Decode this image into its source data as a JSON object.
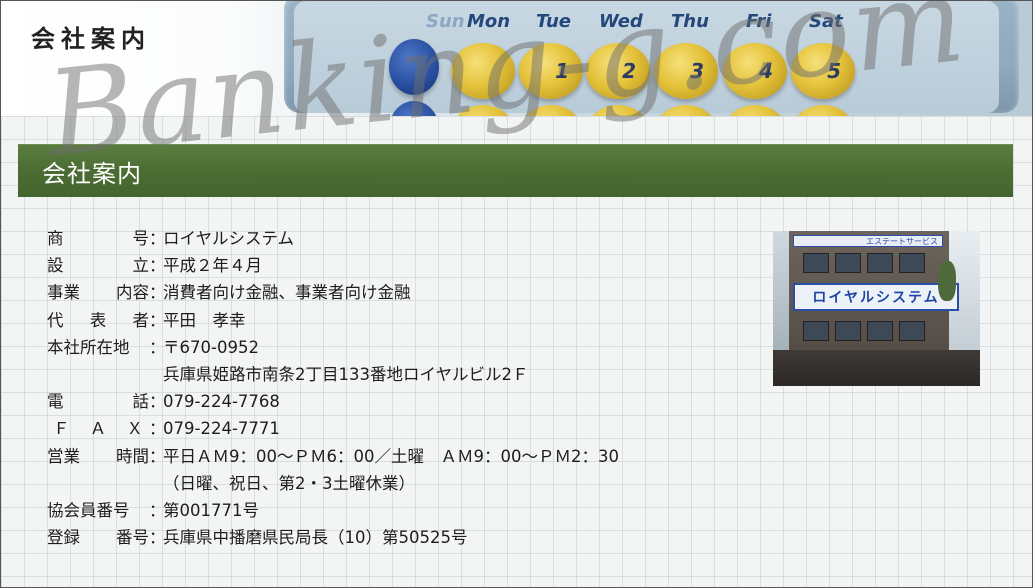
{
  "header": {
    "title": "会社案内",
    "watermark": "Banking-g.com",
    "calendar_days": [
      "Sun",
      "Mon",
      "Tue",
      "Wed",
      "Thu",
      "Fri",
      "Sat"
    ],
    "calendar_dates": [
      "1",
      "2",
      "3",
      "4",
      "5"
    ]
  },
  "section": {
    "title": "会社案内"
  },
  "info": {
    "rows": [
      {
        "label": [
          "商",
          "号"
        ],
        "value": "ロイヤルシステム"
      },
      {
        "label": [
          "設",
          "立"
        ],
        "value": "平成２年４月"
      },
      {
        "label": [
          "事業",
          "内容"
        ],
        "value": "消費者向け金融、事業者向け金融"
      },
      {
        "label": [
          "代",
          "表",
          "者"
        ],
        "value": "平田　孝幸"
      },
      {
        "label": [
          "本社所在地"
        ],
        "value": "〒670-0952"
      },
      {
        "label": [
          ""
        ],
        "value": "兵庫県姫路市南条2丁目133番地ロイヤルビル2Ｆ"
      },
      {
        "label": [
          "電",
          "話"
        ],
        "value": "079-224-7768"
      },
      {
        "label": [
          "Ｆ",
          "Ａ",
          "Ｘ"
        ],
        "value": "079-224-7771"
      },
      {
        "label": [
          "営業",
          "時間"
        ],
        "value": "平日ＡＭ9：00～ＰＭ6：00／土曜　ＡＭ9：00～ＰＭ2：30"
      },
      {
        "label": [
          ""
        ],
        "value": "（日曜、祝日、第2・3土曜休業）"
      },
      {
        "label": [
          "協会員番号"
        ],
        "value": "第001771号"
      },
      {
        "label": [
          "登録",
          "番号"
        ],
        "value": "兵庫県中播磨県民局長（10）第50525号"
      }
    ],
    "separator": "："
  },
  "photo": {
    "sign_top": "エステートサービス",
    "sign_main": "ロイヤルシステム"
  },
  "colors": {
    "band_green": "#4b6d33",
    "grid_line": "#bec3c8",
    "text": "#1d1d1d"
  }
}
